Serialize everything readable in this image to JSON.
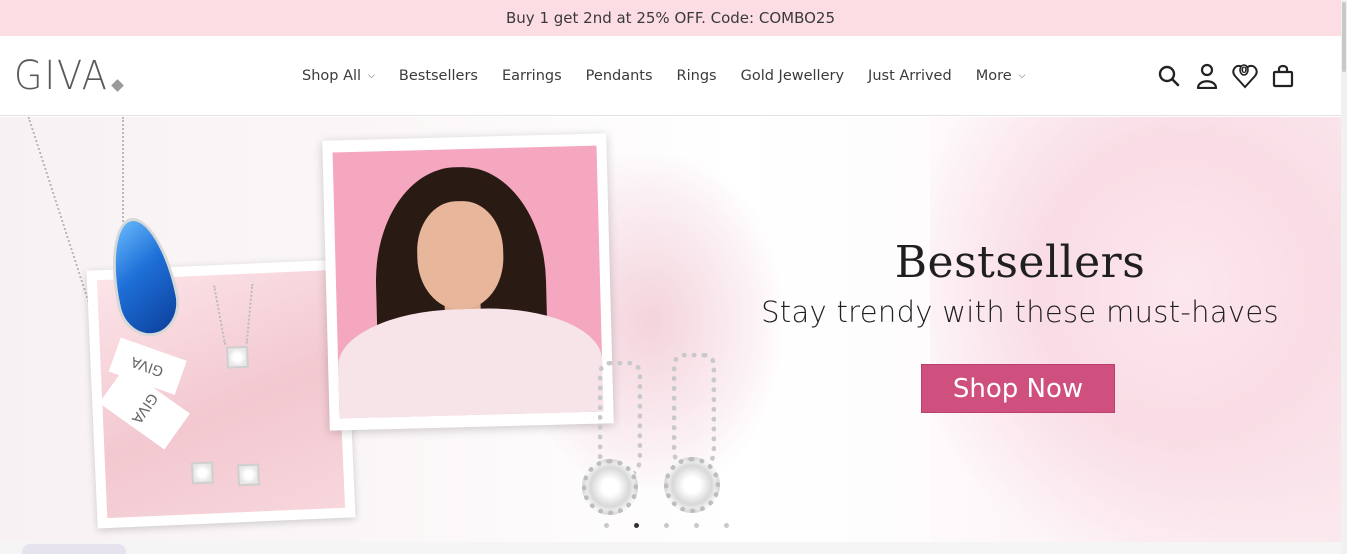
{
  "announcement": {
    "text": "Buy 1 get 2nd at 25% OFF. Code: COMBO25"
  },
  "header": {
    "logo_text": "GIVA",
    "nav": [
      {
        "label": "Shop All",
        "has_dropdown": true
      },
      {
        "label": "Bestsellers",
        "has_dropdown": false
      },
      {
        "label": "Earrings",
        "has_dropdown": false
      },
      {
        "label": "Pendants",
        "has_dropdown": false
      },
      {
        "label": "Rings",
        "has_dropdown": false
      },
      {
        "label": "Gold Jewellery",
        "has_dropdown": false
      },
      {
        "label": "Just Arrived",
        "has_dropdown": false
      },
      {
        "label": "More",
        "has_dropdown": true
      }
    ],
    "icons": [
      "search-icon",
      "account-icon",
      "wishlist-icon",
      "cart-icon"
    ],
    "wishlist_count": "0"
  },
  "hero": {
    "title": "Bestsellers",
    "subtitle": "Stay trendy with these must-haves",
    "cta_label": "Shop Now",
    "tag_text": "GIVA",
    "slides_total": 5,
    "active_slide": 2
  },
  "colors": {
    "announcement_bg": "#fbdde3",
    "cta_bg": "#cf4f7e",
    "text_dark": "#1f1f1f"
  }
}
